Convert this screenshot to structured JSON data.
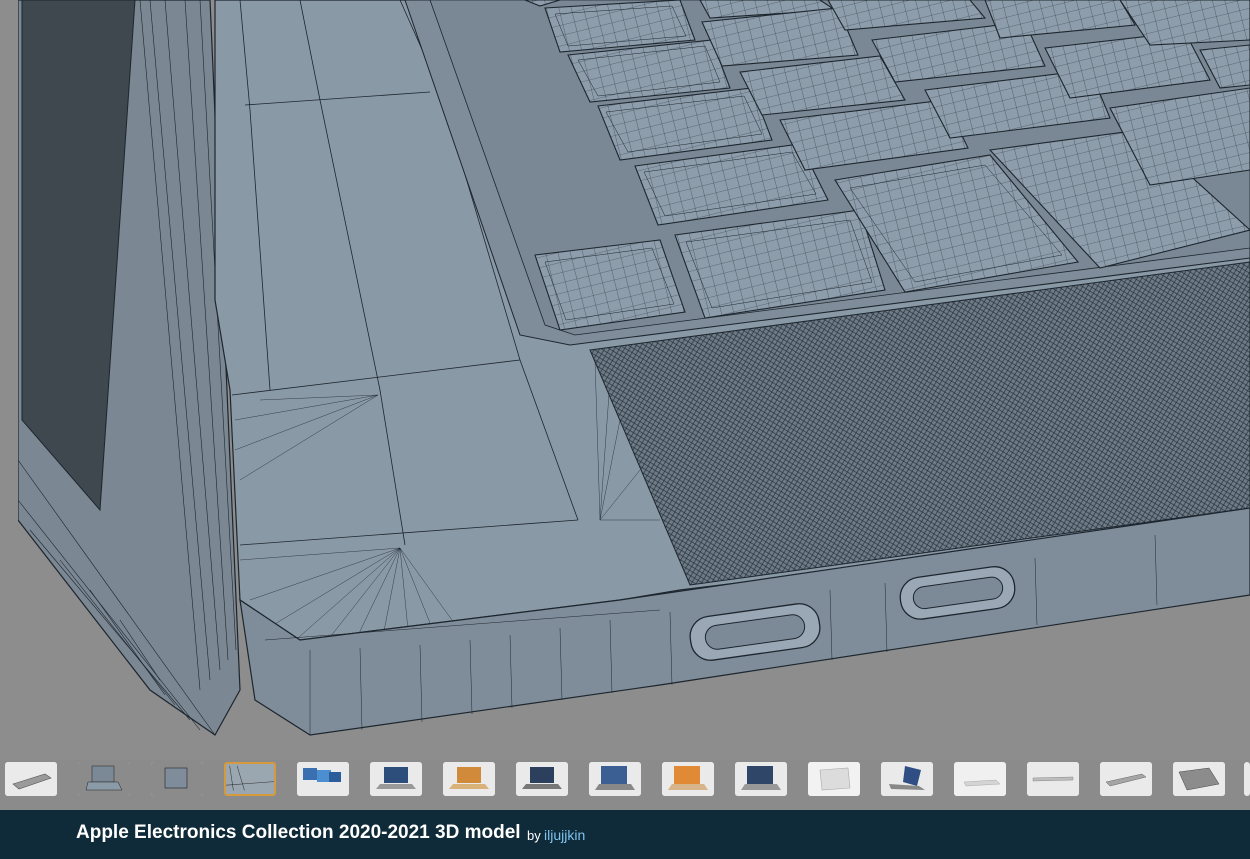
{
  "product": {
    "title": "Apple Electronics Collection 2020-2021 3D model",
    "by_label": "by",
    "author": "iljujjkin"
  },
  "viewer": {
    "selected_thumbnail": 3,
    "thumbnails": [
      {
        "name": "laptop-closed-gray"
      },
      {
        "name": "wireframe-laptop-open"
      },
      {
        "name": "wireframe-mac-mini"
      },
      {
        "name": "wireframe-keyboard-closeup"
      },
      {
        "name": "laptop-trio"
      },
      {
        "name": "macbook-front"
      },
      {
        "name": "macbook-gold"
      },
      {
        "name": "macbook-spacegray"
      },
      {
        "name": "macbook-open-angle"
      },
      {
        "name": "macbook-gold-open"
      },
      {
        "name": "macbook-open-wide"
      },
      {
        "name": "macbook-closed-silver"
      },
      {
        "name": "macbook-side-angle"
      },
      {
        "name": "macbook-closed-white"
      },
      {
        "name": "macbook-flat-silver"
      },
      {
        "name": "macbook-flat-gray"
      },
      {
        "name": "macbook-keyboard-angle"
      }
    ],
    "colors": {
      "wireframe_base": "#8a99a6",
      "wireframe_line": "#1d262e",
      "background": "#8d8d8d",
      "selected_border": "#d49a3d",
      "title_bar": "#0f2a38",
      "author_link": "#7fc3ee"
    }
  }
}
